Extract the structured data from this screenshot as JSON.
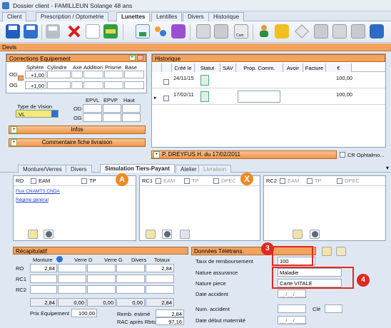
{
  "window": {
    "title": "Dossier client - FAMILLEUN Solange 48 ans"
  },
  "tabs": [
    {
      "label": "Client"
    },
    {
      "label": "Prescription / Optometrie"
    },
    {
      "label": "Lunettes"
    },
    {
      "label": "Lentilles"
    },
    {
      "label": "Divers"
    },
    {
      "label": "Historique"
    }
  ],
  "devis": {
    "label": "Devis"
  },
  "corrections": {
    "title": "Corrections Equipement",
    "plus": "+",
    "columns": [
      "Sphère",
      "Cylindre",
      "Axe",
      "Addition",
      "Prisme",
      "Base"
    ],
    "rows": [
      {
        "eye": "OD",
        "sphere": "+1,00"
      },
      {
        "eye": "OG",
        "sphere": "+1,00"
      }
    ]
  },
  "vision": {
    "label": "Type de Vision",
    "value": "VL",
    "epvl": "EPVL",
    "epvp": "EPVP",
    "haut": "Haut",
    "od": "OD",
    "og": "OG"
  },
  "infos": {
    "plus": "+",
    "label": "Infos"
  },
  "commentaire": {
    "plus": "+",
    "label": "Commentaire fiche livraison"
  },
  "historique": {
    "title": "Historique",
    "columns": [
      "Créé le",
      "Statut",
      "SAV",
      "Prop. Comm.",
      "Avoir",
      "Facture",
      "€"
    ],
    "rows": [
      {
        "date": "24/11/15",
        "amount": "100,00"
      },
      {
        "date": "17/02/11",
        "amount": "100,00"
      }
    ]
  },
  "prescription_bar": {
    "plus": "+",
    "text": "P. DREYFUS H. du 17/02/2011",
    "cr_label": "CR Ophtalmo..."
  },
  "subtabs": [
    {
      "label": "Monture/Verres"
    },
    {
      "label": "Divers"
    },
    {
      "label": "Simulation Tiers-Payant"
    },
    {
      "label": "Atelier"
    },
    {
      "label": "Livraison"
    }
  ],
  "rc_panels": [
    {
      "title": "RO",
      "eam": "EAM",
      "tp": "TP",
      "link1": "Flux CNAMTS CNDA",
      "link2": "Régime général"
    },
    {
      "title": "RC1",
      "eam": "EAM",
      "tp": "TP",
      "dpec": "DPEC"
    },
    {
      "title": "RC2",
      "eam": "EAM",
      "tp": "TP",
      "dpec": "DPEC"
    }
  ],
  "badges": {
    "a": "A",
    "x": "X",
    "three": "3",
    "four": "4"
  },
  "recap": {
    "title": "Récapitulatif",
    "columns": [
      "Monture",
      "Verre D",
      "Verre G",
      "Divers",
      "Totaux"
    ],
    "rows": [
      {
        "label": "RO",
        "monture": "2,84",
        "totaux": "2,84"
      },
      {
        "label": "RC1",
        "monture": "",
        "totaux": ""
      },
      {
        "label": "RC2",
        "monture": "",
        "totaux": ""
      }
    ],
    "totals": [
      "2,84",
      "0,00",
      "0,00",
      "0,00",
      "2,84"
    ],
    "prix_label": "Prix Equipement",
    "prix_value": "100,00",
    "remb_label": "Remb. estimé",
    "remb_value": "2,84",
    "rac_label": "RAC après Rbts",
    "rac_value": "97,16"
  },
  "teletrans": {
    "title": "Données Télétrans.",
    "taux_label": "Taux de remboursement",
    "taux_value": "100",
    "nature_assurance_label": "Nature assurance",
    "nature_assurance_value": "Maladie",
    "nature_piece_label": "Nature piece",
    "nature_piece_value": "Carte VITALE",
    "date_accident_label": "Date accident",
    "date_placeholder": "__/__/____",
    "num_accident_label": "Num. accident",
    "cle_label": "Clé",
    "date_maternite_label": "Date début maternité"
  }
}
